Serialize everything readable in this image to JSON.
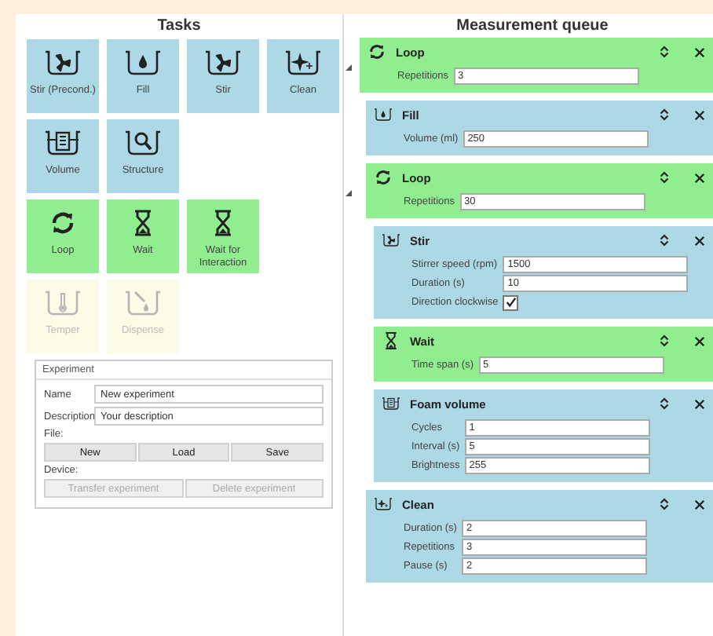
{
  "tasks": {
    "title": "Tasks",
    "rows": [
      {
        "tiles": [
          {
            "label": "Stir (Precond.)",
            "kind": "stir",
            "color": "#add8e6",
            "disabled": false
          },
          {
            "label": "Fill",
            "kind": "fill",
            "color": "#add8e6",
            "disabled": false
          },
          {
            "label": "Stir",
            "kind": "stir",
            "color": "#add8e6",
            "disabled": false
          },
          {
            "label": "Clean",
            "kind": "clean",
            "color": "#add8e6",
            "disabled": false
          }
        ]
      },
      {
        "tiles": [
          {
            "label": "Volume",
            "kind": "volume",
            "color": "#add8e6",
            "disabled": false
          },
          {
            "label": "Structure",
            "kind": "structure",
            "color": "#add8e6",
            "disabled": false
          }
        ]
      },
      {
        "tiles": [
          {
            "label": "Loop",
            "kind": "loop",
            "color": "#90ee90",
            "disabled": false
          },
          {
            "label": "Wait",
            "kind": "wait",
            "color": "#90ee90",
            "disabled": false
          },
          {
            "label": "Wait for Interaction",
            "kind": "wait",
            "color": "#90ee90",
            "disabled": false
          }
        ]
      },
      {
        "tiles": [
          {
            "label": "Temper",
            "kind": "temper",
            "color": "#fbfbe8",
            "disabled": true
          },
          {
            "label": "Dispense",
            "kind": "dispense",
            "color": "#fbfbe8",
            "disabled": true
          }
        ]
      }
    ]
  },
  "experiment": {
    "title": "Experiment",
    "fields": [
      {
        "label": "Name",
        "value": "New experiment"
      },
      {
        "label": "Description",
        "value": "Your description"
      }
    ],
    "file_label": "File:",
    "file_buttons": [
      {
        "label": "New",
        "disabled": false
      },
      {
        "label": "Load",
        "disabled": false
      },
      {
        "label": "Save",
        "disabled": false
      }
    ],
    "device_label": "Device:",
    "device_buttons": [
      {
        "label": "Transfer experiment",
        "disabled": true
      },
      {
        "label": "Delete experiment",
        "disabled": true
      }
    ]
  },
  "queue": {
    "title": "Measurement queue",
    "items": [
      {
        "kind": "loop",
        "title": "Loop",
        "color": "#90ee90",
        "expanded": true,
        "fields": [
          {
            "kind": "text",
            "label": "Repetitions",
            "value": "3"
          }
        ],
        "children": [
          {
            "kind": "fill",
            "title": "Fill",
            "color": "#add8e6",
            "fields": [
              {
                "kind": "text",
                "label": "Volume (ml)",
                "value": "250"
              }
            ]
          },
          {
            "kind": "loop",
            "title": "Loop",
            "color": "#90ee90",
            "expanded": true,
            "fields": [
              {
                "kind": "text",
                "label": "Repetitions",
                "value": "30"
              }
            ],
            "children": [
              {
                "kind": "stir",
                "title": "Stir",
                "color": "#add8e6",
                "fields": [
                  {
                    "kind": "text",
                    "label": "Stirrer speed (rpm)",
                    "value": "1500"
                  },
                  {
                    "kind": "text",
                    "label": "Duration (s)",
                    "value": "10"
                  },
                  {
                    "kind": "checkbox",
                    "label": "Direction clockwise",
                    "checked": true
                  }
                ]
              },
              {
                "kind": "wait",
                "title": "Wait",
                "color": "#90ee90",
                "fields": [
                  {
                    "kind": "text",
                    "label": "Time span (s)",
                    "value": "5"
                  }
                ]
              },
              {
                "kind": "volume",
                "title": "Foam volume",
                "color": "#add8e6",
                "fields": [
                  {
                    "kind": "text",
                    "label": "Cycles",
                    "value": "1"
                  },
                  {
                    "kind": "text",
                    "label": "Interval (s)",
                    "value": "5"
                  },
                  {
                    "kind": "text",
                    "label": "Brightness",
                    "value": "255"
                  }
                ]
              }
            ]
          },
          {
            "kind": "clean",
            "title": "Clean",
            "color": "#add8e6",
            "fields": [
              {
                "kind": "text",
                "label": "Duration (s)",
                "value": "2"
              },
              {
                "kind": "text",
                "label": "Repetitions",
                "value": "3"
              },
              {
                "kind": "text",
                "label": "Pause (s)",
                "value": "2"
              }
            ]
          }
        ]
      }
    ]
  }
}
